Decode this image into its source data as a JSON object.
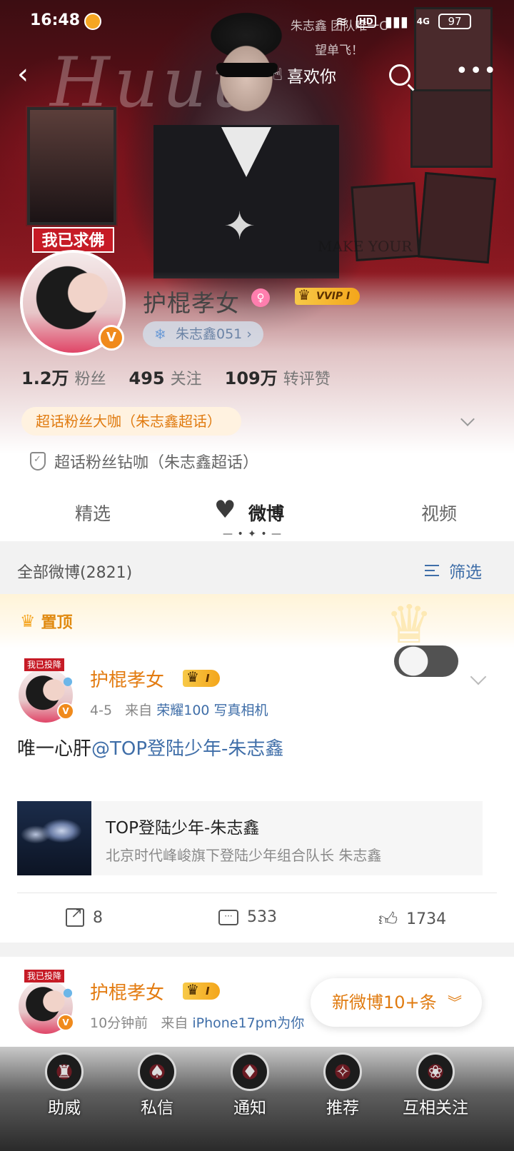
{
  "status_bar": {
    "time": "16:48",
    "hd": "HD",
    "network": "4G",
    "battery": "97"
  },
  "nav": {
    "like_label": "喜欢你"
  },
  "cover": {
    "note": "朱志鑫 团队唯一C 望单飞！",
    "script_text": "Huuu",
    "make_text": "MAKE YOUR",
    "tag": "我已求佛"
  },
  "profile": {
    "name": "护棍孝女",
    "vvip": "VVIP I",
    "super_chip": "朱志鑫051 ›",
    "stats": [
      {
        "num": "1.2万",
        "label": "粉丝"
      },
      {
        "num": "495",
        "label": "关注"
      },
      {
        "num": "109万",
        "label": "转评赞"
      }
    ],
    "fan_tag": "超话粉丝大咖（朱志鑫超话）",
    "diamond_tag": "超话粉丝钻咖（朱志鑫超话）"
  },
  "tabs": [
    "精选",
    "微博",
    "视频"
  ],
  "filter_bar": {
    "all_label": "全部微博(2821)",
    "filter_label": "筛选"
  },
  "pinned": {
    "label": "置顶",
    "author": "护棍孝女",
    "rank": "I",
    "date": "4-5",
    "from_prefix": "来自",
    "source": "荣耀100 写真相机",
    "text_prefix": "唯一心肝",
    "mention": "@TOP登陆少年-朱志鑫",
    "card_title": "TOP登陆少年-朱志鑫",
    "card_sub": "北京时代峰峻旗下登陆少年组合队长 朱志鑫",
    "tag": "我已投降",
    "actions": {
      "share": "8",
      "comment": "533",
      "like": "1734"
    }
  },
  "post2": {
    "author": "护棍孝女",
    "rank": "I",
    "time": "10分钟前",
    "from_prefix": "来自",
    "source": "iPhone17pm为你",
    "tag": "我已投降"
  },
  "new_posts": "新微博10+条",
  "bottom_bar": [
    "助威",
    "私信",
    "通知",
    "推荐",
    "互相关注"
  ]
}
